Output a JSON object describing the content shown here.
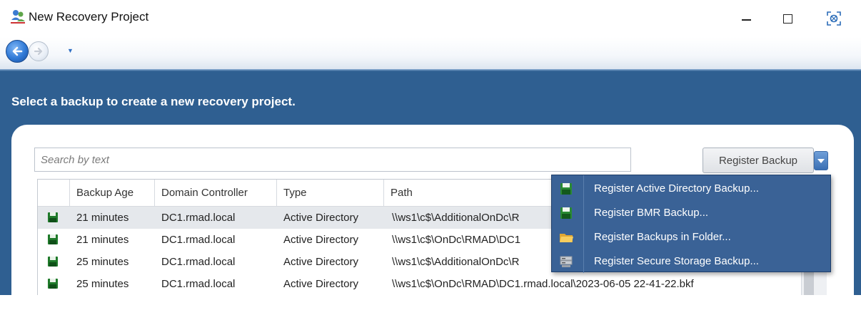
{
  "window": {
    "title": "New Recovery Project",
    "icons": {
      "app": "recovery-app-icon",
      "minimize": "minimize-icon",
      "maximize": "maximize-icon",
      "close": "close-icon"
    }
  },
  "nav": {
    "back": "back-arrow-icon",
    "forward": "forward-arrow-icon",
    "history": "history-dropdown-icon"
  },
  "heading": "Select a backup to create a new recovery project.",
  "search": {
    "placeholder": "Search by text",
    "value": ""
  },
  "register_button": {
    "label": "Register Backup",
    "dropdown_icon": "chevron-down-icon"
  },
  "table": {
    "columns": [
      "",
      "Backup Age",
      "Domain Controller",
      "Type",
      "Path"
    ],
    "rows": [
      {
        "icon": "disk-icon",
        "age": "21 minutes",
        "dc": "DC1.rmad.local",
        "type": "Active Directory",
        "path": "\\\\ws1\\c$\\AdditionalOnDc\\R",
        "selected": true
      },
      {
        "icon": "disk-icon",
        "age": "21 minutes",
        "dc": "DC1.rmad.local",
        "type": "Active Directory",
        "path": "\\\\ws1\\c$\\OnDc\\RMAD\\DC1",
        "selected": false
      },
      {
        "icon": "disk-icon",
        "age": "25 minutes",
        "dc": "DC1.rmad.local",
        "type": "Active Directory",
        "path": "\\\\ws1\\c$\\AdditionalOnDc\\R",
        "selected": false
      },
      {
        "icon": "disk-icon",
        "age": "25 minutes",
        "dc": "DC1.rmad.local",
        "type": "Active Directory",
        "path": "\\\\ws1\\c$\\OnDc\\RMAD\\DC1.rmad.local\\2023-06-05 22-41-22.bkf",
        "selected": false
      }
    ]
  },
  "register_menu": {
    "items": [
      {
        "label": "Register Active Directory Backup...",
        "icon": "disk-icon"
      },
      {
        "label": "Register BMR Backup...",
        "icon": "disk-icon"
      },
      {
        "label": "Register Backups in Folder...",
        "icon": "folder-icon"
      },
      {
        "label": "Register Secure Storage Backup...",
        "icon": "storage-server-icon"
      }
    ]
  },
  "colors": {
    "band": "#2f5f91",
    "menu": "#3a6296",
    "accent_blue": "#3a6fb4"
  }
}
